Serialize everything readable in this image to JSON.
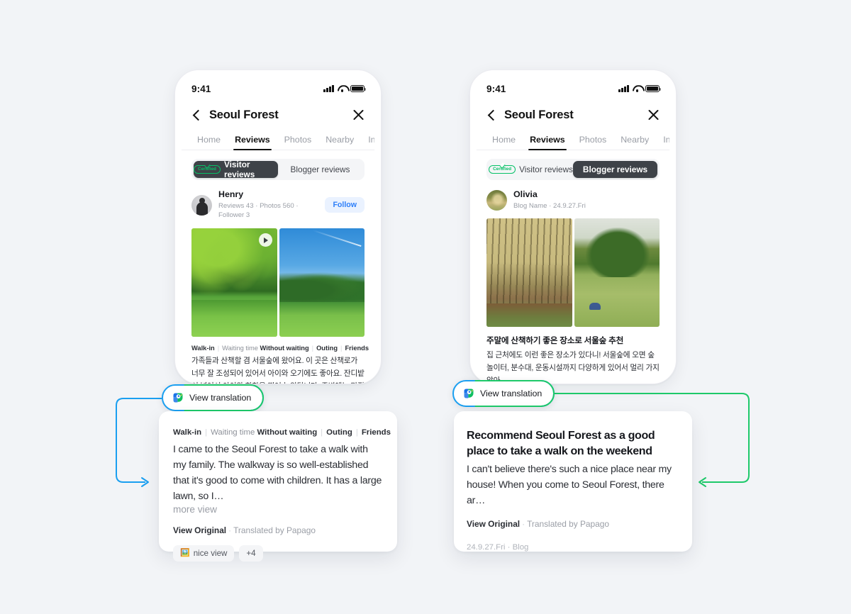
{
  "statusbar": {
    "time": "9:41",
    "icons": [
      "signal-icon",
      "wifi-icon",
      "battery-icon"
    ]
  },
  "nav": {
    "title": "Seoul Forest",
    "back_icon": "chevron-left-icon",
    "close_icon": "close-icon"
  },
  "tabs": [
    {
      "label": "Home",
      "active": false
    },
    {
      "label": "Reviews",
      "active": true
    },
    {
      "label": "Photos",
      "active": false
    },
    {
      "label": "Nearby",
      "active": false
    },
    {
      "label": "Info",
      "active": false
    }
  ],
  "segments": {
    "visitor": "Visitor reviews",
    "blogger": "Blogger reviews",
    "certified_badge": "Certified"
  },
  "left_phone": {
    "active_segment": "Visitor reviews",
    "author": {
      "name": "Henry",
      "meta": "Reviews 43 · Photos 560 · Follower 3",
      "follow_label": "Follow",
      "avatar": "henry-avatar"
    },
    "photos": [
      {
        "name": "willow-lawn-photo",
        "has_play": true
      },
      {
        "name": "blue-sky-park-photo",
        "has_play": false
      }
    ],
    "chips": {
      "walk_in": "Walk-in",
      "waiting_label": "Waiting time",
      "waiting_value": "Without waiting",
      "outing": "Outing",
      "friends": "Friends"
    },
    "review_korean": "가족들과 산책할 겸 서울숲에 왔어요. 이 곳은 산책로가 너무 잘 조성되어 있어서 아이와 오기에도 좋아요. 잔디밭이 넓어서 아이와 한참을 뛰어 놀았답니다. 주변에는 맛집과 카페도 많아요…",
    "view_translation": "View translation"
  },
  "right_phone": {
    "active_segment": "Blogger reviews",
    "author": {
      "name": "Olivia",
      "meta": "Blog Name · 24.9.27.Fri",
      "avatar": "olivia-avatar"
    },
    "photos": [
      {
        "name": "birch-forest-photo",
        "has_play": false
      },
      {
        "name": "big-tree-lawn-photo",
        "has_play": false
      }
    ],
    "blog_title_korean": "주말에 산책하기 좋은 장소로 서울숲 추천",
    "blog_body_korean": "집 근처에도 이런 좋은 장소가 있다니! 서울숲에 오면 숲놀이터, 분수대, 운동시설까지 다양하게 있어서 멀리 가지 않아…",
    "view_translation": "View translation"
  },
  "left_card": {
    "chips": {
      "walk_in": "Walk-in",
      "waiting_label": "Waiting time",
      "waiting_value": "Without waiting",
      "outing": "Outing",
      "friends": "Friends"
    },
    "translated_text": "I came to the Seoul Forest to take a walk with my family. The walkway is so well-established that it's good to come with children. It has a large lawn, so I…",
    "more_view": "more view",
    "view_original": "View Original",
    "translated_by": "Translated by Papago",
    "tags": [
      {
        "emoji": "🖼️",
        "label": "nice view"
      },
      {
        "emoji": "",
        "label": "+4"
      }
    ]
  },
  "right_card": {
    "title": "Recommend Seoul Forest as a good place to take a walk on the weekend",
    "translated_text": "I can't believe there's such a nice place near my house! When you come to Seoul Forest, there ar…",
    "view_original": "View Original",
    "translated_by": "Translated by Papago",
    "date_meta": "24.9.27.Fri · Blog"
  },
  "colors": {
    "background": "#f2f4f7",
    "accent_blue": "#1a9ff0",
    "accent_green": "#1ec96a",
    "follow_blue": "#2d7ff9",
    "certified_green": "#06c167",
    "dark_pill": "#3e4248"
  }
}
